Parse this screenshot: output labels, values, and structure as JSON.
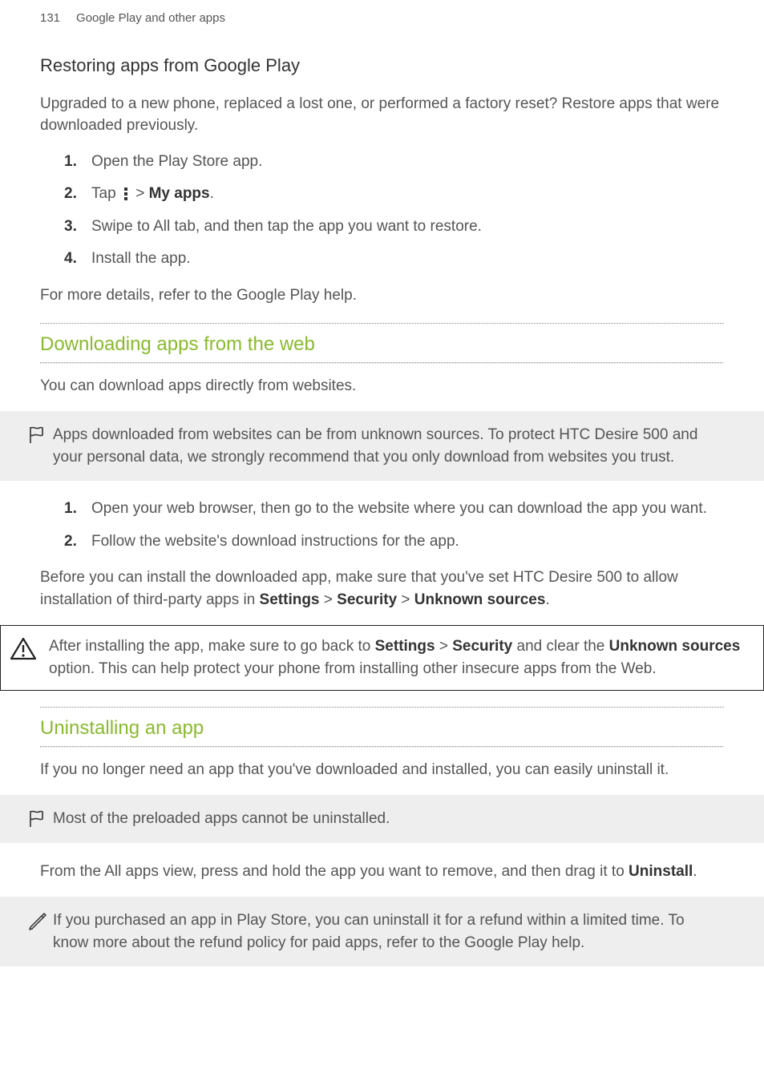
{
  "header": {
    "page_number": "131",
    "chapter": "Google Play and other apps"
  },
  "s1": {
    "title": "Restoring apps from Google Play",
    "intro": "Upgraded to a new phone, replaced a lost one, or performed a factory reset? Restore apps that were downloaded previously.",
    "steps": {
      "a": "Open the Play Store app.",
      "b_pre": "Tap ",
      "b_post": " > ",
      "b_bold": "My apps",
      "b_end": ".",
      "c": "Swipe to All tab, and then tap the app you want to restore.",
      "d": "Install the app."
    },
    "outro": "For more details, refer to the Google Play help."
  },
  "s2": {
    "title": "Downloading apps from the web",
    "intro": "You can download apps directly from websites.",
    "note": "Apps downloaded from websites can be from unknown sources. To protect HTC Desire 500 and your personal data, we strongly recommend that you only download from websites you trust.",
    "steps": {
      "a": "Open your web browser, then go to the website where you can download the app you want.",
      "b": "Follow the website's download instructions for the app."
    },
    "outro_pre": "Before you can install the downloaded app, make sure that you've set HTC Desire 500 to allow installation of third-party apps in ",
    "settings": "Settings",
    "gt1": " > ",
    "security": "Security",
    "gt2": " > ",
    "unknown": "Unknown sources",
    "outro_end": ".",
    "warn_pre": "After installing the app, make sure to go back to ",
    "warn_settings": "Settings",
    "warn_gt": " > ",
    "warn_security": "Security",
    "warn_mid": " and clear the ",
    "warn_unknown": "Unknown sources",
    "warn_post": " option. This can help protect your phone from installing other insecure apps from the Web."
  },
  "s3": {
    "title": "Uninstalling an app",
    "intro": "If you no longer need an app that you've downloaded and installed, you can easily uninstall it.",
    "note": "Most of the preloaded apps cannot be uninstalled.",
    "body_pre": "From the All apps view, press and hold the app you want to remove, and then drag it to ",
    "uninstall": "Uninstall",
    "body_end": ".",
    "tip": "If you purchased an app in Play Store, you can uninstall it for a refund within a limited time. To know more about the refund policy for paid apps, refer to the Google Play help."
  }
}
